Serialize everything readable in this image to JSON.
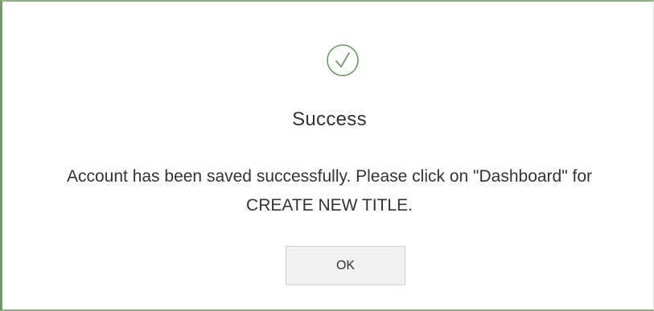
{
  "dialog": {
    "icon": "check-circle-icon",
    "title": "Success",
    "message": "Account has been saved successfully. Please click on \"Dashboard\" for CREATE NEW TITLE.",
    "ok_label": "OK",
    "colors": {
      "accent": "#6f9a64",
      "text": "#333333",
      "button_bg": "#f2f2f2"
    }
  }
}
